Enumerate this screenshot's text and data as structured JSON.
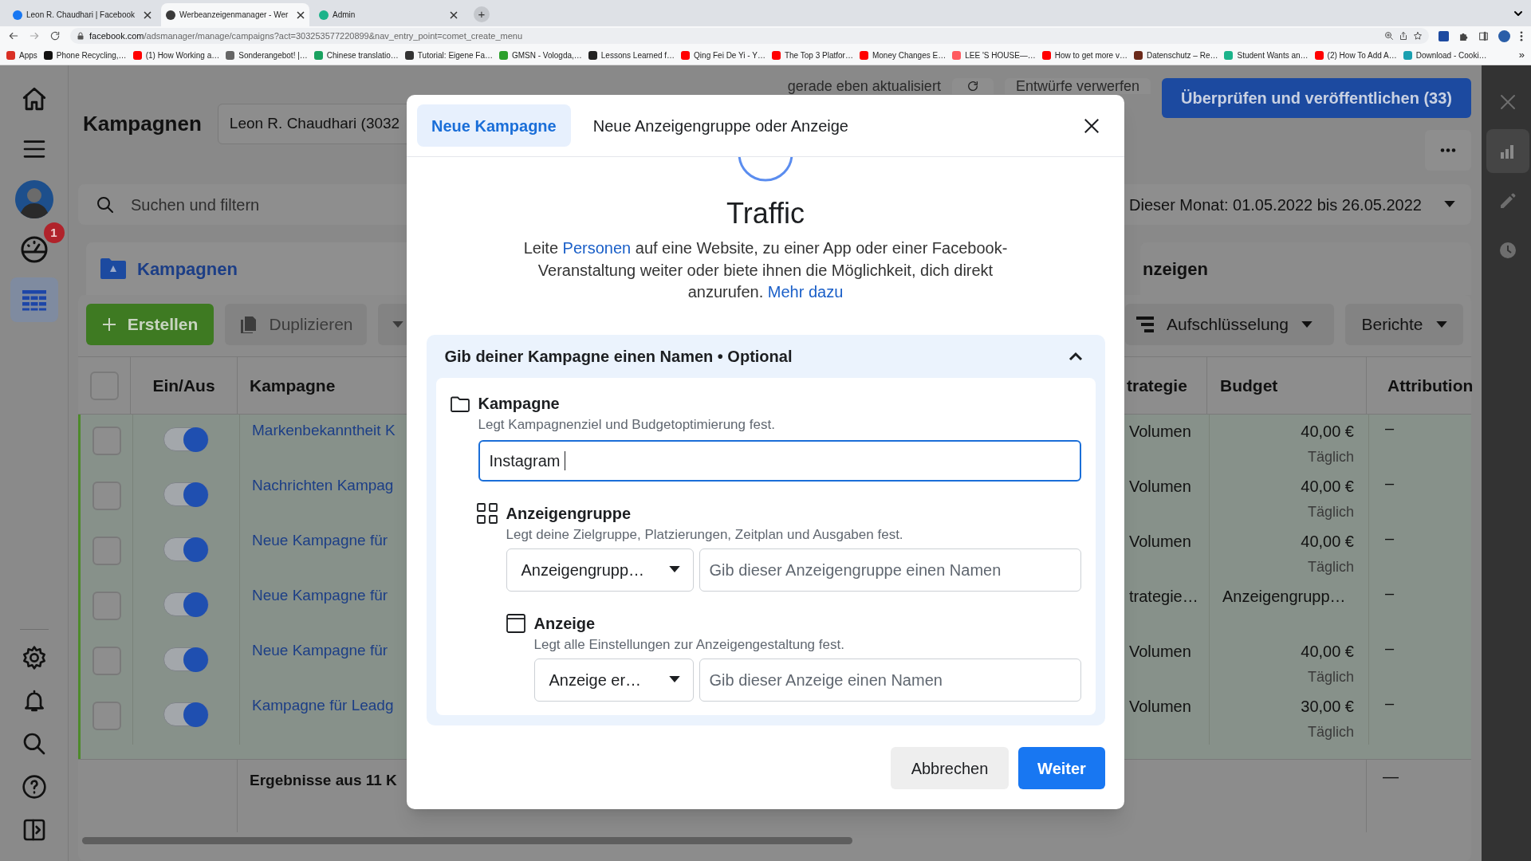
{
  "browser": {
    "tabs": [
      {
        "title": "Leon R. Chaudhari | Facebook",
        "selected": false,
        "color": "#1877f2"
      },
      {
        "title": "Werbeanzeigenmanager - Wer",
        "selected": true,
        "color": "#3a3a3a"
      },
      {
        "title": "Admin",
        "selected": false,
        "color": "#1bb38a"
      }
    ],
    "new_tab": "+",
    "url": {
      "host": "facebook.com",
      "path": "/adsmanager/manage/campaigns?act=303253577220899&nav_entry_point=comet_create_menu"
    },
    "bookmarks": [
      {
        "label": "Apps",
        "color": "#d93025"
      },
      {
        "label": "Phone Recycling,…",
        "color": "#111111"
      },
      {
        "label": "(1) How Working a…",
        "color": "#ff0000"
      },
      {
        "label": "Sonderangebot! |…",
        "color": "#666666"
      },
      {
        "label": "Chinese translatio…",
        "color": "#1aa260"
      },
      {
        "label": "Tutorial: Eigene Fa…",
        "color": "#333333"
      },
      {
        "label": "GMSN - Vologda,…",
        "color": "#2ca02c"
      },
      {
        "label": "Lessons Learned f…",
        "color": "#222222"
      },
      {
        "label": "Qing Fei De Yi - Y…",
        "color": "#ff0000"
      },
      {
        "label": "The Top 3 Platfor…",
        "color": "#ff0000"
      },
      {
        "label": "Money Changes E…",
        "color": "#ff0000"
      },
      {
        "label": "LEE 'S HOUSE—…",
        "color": "#ff5a5f"
      },
      {
        "label": "How to get more v…",
        "color": "#ff0000"
      },
      {
        "label": "Datenschutz – Re…",
        "color": "#6b2a1a"
      },
      {
        "label": "Student Wants an…",
        "color": "#1bb38a"
      },
      {
        "label": "(2) How To Add A…",
        "color": "#ff0000"
      },
      {
        "label": "Download - Cooki…",
        "color": "#1aa0b0"
      }
    ],
    "bookmarks_more": "»"
  },
  "nav_rail": {
    "top_items": [
      {
        "kind": "home",
        "selected": false
      },
      {
        "kind": "menu",
        "selected": false
      },
      {
        "kind": "avatar",
        "selected": false
      },
      {
        "kind": "gauge",
        "selected": false,
        "badge": "1"
      },
      {
        "kind": "table",
        "selected": true
      }
    ],
    "bottom_items": [
      {
        "kind": "gear",
        "selected": false
      },
      {
        "kind": "bell",
        "selected": false
      },
      {
        "kind": "search",
        "selected": false
      },
      {
        "kind": "help",
        "selected": false
      },
      {
        "kind": "panel",
        "selected": false
      }
    ]
  },
  "header": {
    "title": "Kampagnen",
    "account": "Leon R. Chaudhari (3032",
    "status": "gerade eben aktualisiert",
    "discard": "Entwürfe verwerfen",
    "publish": "Überprüfen und veröffentlichen (33)"
  },
  "search": {
    "placeholder": "Suchen und filtern"
  },
  "date_range": "Dieser Monat: 01.05.2022 bis 26.05.2022",
  "level_tabs": [
    {
      "label": "Kampagnen",
      "selected": true
    },
    {
      "label": "nzeigen",
      "selected": false
    }
  ],
  "toolbar": {
    "create": "Erstellen",
    "duplicate": "Duplizieren",
    "breakdown": "Aufschlüsselung",
    "reports": "Berichte"
  },
  "table": {
    "header_checked": false,
    "columns": [
      "Ein/Aus",
      "Kampagne",
      "trategie",
      "Budget",
      "Attribution"
    ],
    "rows": [
      {
        "checked": false,
        "on": true,
        "name": "Markenbekanntheit K",
        "strategy": "Volumen",
        "budget": "40,00 €",
        "budget_period": "Täglich",
        "attribution": "–"
      },
      {
        "checked": false,
        "on": true,
        "name": "Nachrichten Kampag",
        "strategy": "Volumen",
        "budget": "40,00 €",
        "budget_period": "Täglich",
        "attribution": "–"
      },
      {
        "checked": false,
        "on": true,
        "name": "Neue Kampagne für",
        "strategy": "Volumen",
        "budget": "40,00 €",
        "budget_period": "Täglich",
        "attribution": "–"
      },
      {
        "checked": false,
        "on": true,
        "name": "Neue Kampagne für",
        "strategy": "trategie…",
        "budget": "Anzeigengrupp…",
        "attribution": "–"
      },
      {
        "checked": false,
        "on": true,
        "name": "Neue Kampagne für",
        "strategy": "Volumen",
        "budget": "40,00 €",
        "budget_period": "Täglich",
        "attribution": "–"
      },
      {
        "checked": false,
        "on": true,
        "name": "Kampagne für Leadg",
        "strategy": "Volumen",
        "budget": "30,00 €",
        "budget_period": "Täglich",
        "attribution": "–"
      }
    ],
    "footer": {
      "label": "Ergebnisse aus 11 K",
      "attribution": "—"
    }
  },
  "side_panel": {
    "items": [
      {
        "kind": "close",
        "selected": false
      },
      {
        "kind": "chart",
        "selected": true
      },
      {
        "kind": "pencil",
        "selected": false
      },
      {
        "kind": "clock",
        "selected": false
      }
    ]
  },
  "modal": {
    "tabs": [
      {
        "label": "Neue Kampagne",
        "selected": true
      },
      {
        "label": "Neue Anzeigengruppe oder Anzeige",
        "selected": false
      }
    ],
    "objective": "Traffic",
    "description": [
      {
        "text": "Leite "
      },
      {
        "text": "Personen",
        "link": true
      },
      {
        "text": " auf eine Website, zu einer App oder einer Facebook-Veranstaltung weiter oder biete ihnen die Möglichkeit, dich direkt anzurufen. "
      },
      {
        "text": "Mehr dazu",
        "link": true
      }
    ],
    "naming": {
      "title": "Gib deiner Kampagne einen Namen • Optional",
      "expanded": true,
      "campaign": {
        "title": "Kampagne",
        "subtitle": "Legt Kampagnenziel und Budgetoptimierung fest.",
        "value": "Instagram "
      },
      "ad_set": {
        "title": "Anzeigengruppe",
        "subtitle": "Legt deine Zielgruppe, Platzierungen, Zeitplan und Ausgaben fest.",
        "dropdown": "Anzeigengrupp…",
        "placeholder": "Gib dieser Anzeigengruppe einen Namen"
      },
      "ad": {
        "title": "Anzeige",
        "subtitle": "Legt alle Einstellungen zur Anzeigengestaltung fest.",
        "dropdown": "Anzeige er…",
        "placeholder": "Gib dieser Anzeige einen Namen"
      }
    },
    "buttons": {
      "cancel": "Abbrechen",
      "next": "Weiter"
    }
  }
}
